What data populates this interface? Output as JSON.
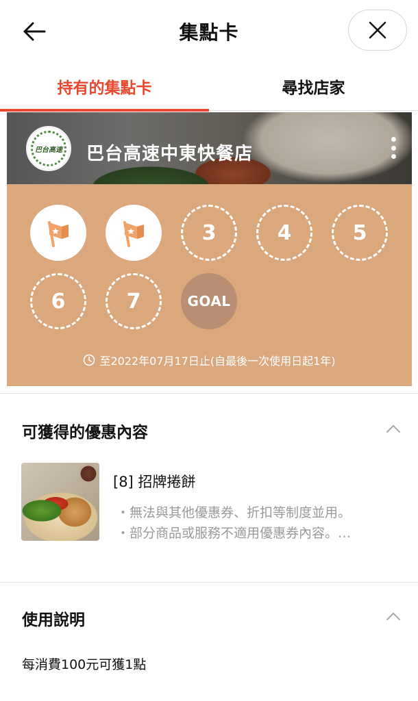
{
  "header": {
    "title": "集點卡"
  },
  "tabs": [
    {
      "label": "持有的集點卡",
      "active": true
    },
    {
      "label": "尋找店家",
      "active": false
    }
  ],
  "card": {
    "shop_name": "巴台高速中東快餐店",
    "logo_text": "巴台高速",
    "background_color": "#dba77c",
    "stamps": [
      {
        "state": "filled",
        "label": ""
      },
      {
        "state": "filled",
        "label": ""
      },
      {
        "state": "empty",
        "label": "3"
      },
      {
        "state": "empty",
        "label": "4"
      },
      {
        "state": "empty",
        "label": "5"
      },
      {
        "state": "empty",
        "label": "6"
      },
      {
        "state": "empty",
        "label": "7"
      },
      {
        "state": "goal",
        "label": "GOAL"
      }
    ],
    "stamps_collected": 2,
    "expiry_text": "至2022年07月17日止(自最後一次使用日起1年)"
  },
  "rewards": {
    "title": "可獲得的優惠內容",
    "item": {
      "name": "[8] 招牌捲餅",
      "notes": [
        "・無法與其他優惠券、折扣等制度並用。",
        "・部分商品或服務不適用優惠券內容。…"
      ]
    }
  },
  "usage": {
    "title": "使用說明",
    "text": "每消費100元可獲1點"
  },
  "colors": {
    "accent": "#e8482e",
    "card": "#dba77c",
    "goal": "#b88f73",
    "muted_text": "#9a9a9a"
  }
}
